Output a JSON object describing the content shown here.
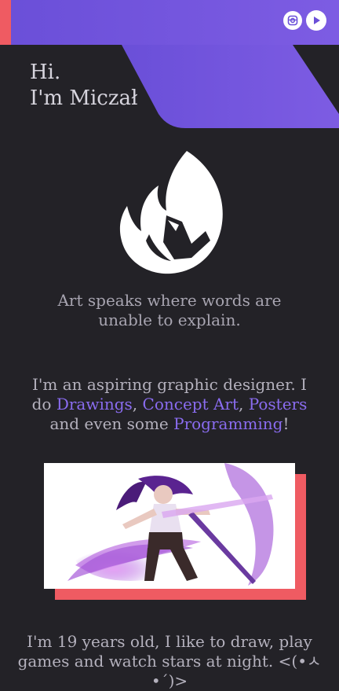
{
  "header": {
    "social": [
      {
        "icon": "instagram-icon"
      },
      {
        "icon": "youtube-play-icon"
      }
    ]
  },
  "hero": {
    "greeting_line1": "Hi.",
    "greeting_line2": "I'm Miczał"
  },
  "logo": {
    "icon": "fox-flame-logo"
  },
  "tagline": "Art speaks where words are unable to explain.",
  "intro": {
    "text_before": "I'm an aspiring graphic designer. I do ",
    "link_drawings": "Drawings",
    "sep1": ", ",
    "link_concept_art": "Concept Art",
    "sep2": ", ",
    "link_posters": "Posters",
    "text_mid": " and even some ",
    "link_programming": "Programming",
    "text_after": "!"
  },
  "artwork": {
    "subject": "purple-haired-warrior-illustration"
  },
  "about": "I'm 19 years old, I like to draw, play games and watch stars at night. <(•ㅅ•´)>",
  "colors": {
    "background": "#232227",
    "purple": "#7356de",
    "link": "#8a6cf0",
    "accent": "#ef5b62"
  }
}
